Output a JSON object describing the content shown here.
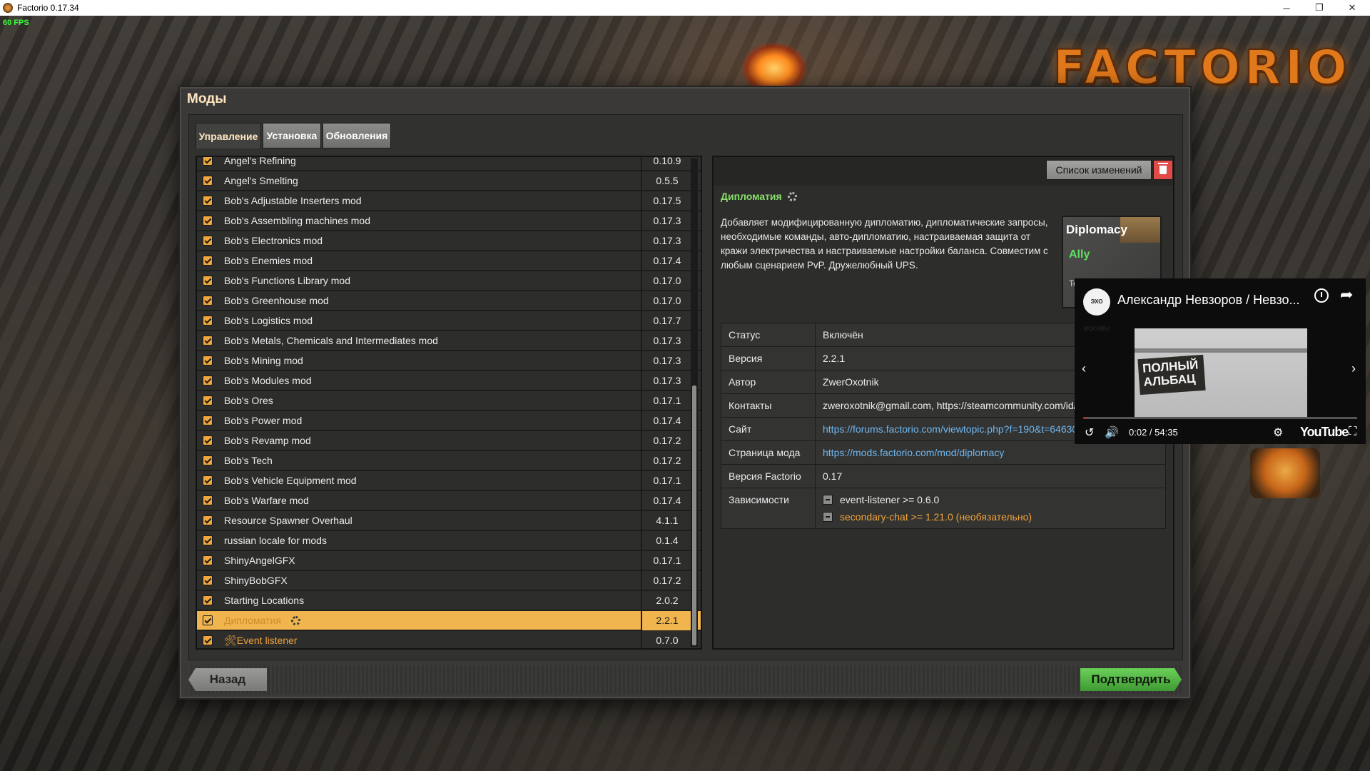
{
  "window": {
    "title": "Factorio 0.17.34",
    "minimize": "─",
    "maximize": "❐",
    "close": "✕"
  },
  "overlay": {
    "fps": "60 FPS",
    "logo": "FACTORIO"
  },
  "dialog": {
    "title": "Моды",
    "tabs": [
      {
        "label": "Управление",
        "active": true
      },
      {
        "label": "Установка",
        "active": false
      },
      {
        "label": "Обновления",
        "active": false
      }
    ]
  },
  "mods": [
    {
      "name": "Angel's Refining",
      "version": "0.10.9"
    },
    {
      "name": "Angel's Smelting",
      "version": "0.5.5"
    },
    {
      "name": "Bob's Adjustable Inserters mod",
      "version": "0.17.5"
    },
    {
      "name": "Bob's Assembling machines mod",
      "version": "0.17.3"
    },
    {
      "name": "Bob's Electronics mod",
      "version": "0.17.3"
    },
    {
      "name": "Bob's Enemies mod",
      "version": "0.17.4"
    },
    {
      "name": "Bob's Functions Library mod",
      "version": "0.17.0"
    },
    {
      "name": "Bob's Greenhouse mod",
      "version": "0.17.0"
    },
    {
      "name": "Bob's Logistics mod",
      "version": "0.17.7"
    },
    {
      "name": "Bob's Metals, Chemicals and Intermediates mod",
      "version": "0.17.3"
    },
    {
      "name": "Bob's Mining mod",
      "version": "0.17.3"
    },
    {
      "name": "Bob's Modules mod",
      "version": "0.17.3"
    },
    {
      "name": "Bob's Ores",
      "version": "0.17.1"
    },
    {
      "name": "Bob's Power mod",
      "version": "0.17.4"
    },
    {
      "name": "Bob's Revamp mod",
      "version": "0.17.2"
    },
    {
      "name": "Bob's Tech",
      "version": "0.17.2"
    },
    {
      "name": "Bob's Vehicle Equipment mod",
      "version": "0.17.1"
    },
    {
      "name": "Bob's Warfare mod",
      "version": "0.17.4"
    },
    {
      "name": "Resource Spawner Overhaul",
      "version": "4.1.1"
    },
    {
      "name": "russian locale for mods",
      "version": "0.1.4"
    },
    {
      "name": "ShinyAngelGFX",
      "version": "0.17.1"
    },
    {
      "name": "ShinyBobGFX",
      "version": "0.17.2"
    },
    {
      "name": "Starting Locations",
      "version": "2.0.2"
    },
    {
      "name": "Дипломатия",
      "version": "2.2.1",
      "selected": true
    },
    {
      "name": "🛠Event listener",
      "version": "0.7.0",
      "dependency": true
    }
  ],
  "details": {
    "changelog_label": "Список изменений",
    "mod_title": "Дипломатия",
    "description": "Добавляет модифицированную дипломатию, дипломатические запросы, необходимые команды, авто-дипломатию, настраиваемая защита от кражи электричества и настраиваемые настройки баланса. Совместим с любым сценарием PvP. Дружелюбный UPS.",
    "thumbnail": {
      "title": "Diplomacy",
      "ally": "Ally",
      "extra": "Te"
    },
    "info": [
      {
        "key": "Статус",
        "value": "Включён"
      },
      {
        "key": "Версия",
        "value": "2.2.1"
      },
      {
        "key": "Автор",
        "value": "ZwerOxotnik"
      },
      {
        "key": "Контакты",
        "value": "zweroxotnik@gmail.com, https://steamcommunity.com/id/zwer"
      },
      {
        "key": "Сайт",
        "value": "https://forums.factorio.com/viewtopic.php?f=190&t=64630",
        "link": true
      },
      {
        "key": "Страница мода",
        "value": "https://mods.factorio.com/mod/diplomacy",
        "link": true
      },
      {
        "key": "Версия Factorio",
        "value": "0.17"
      }
    ],
    "dependencies_label": "Зависимости",
    "dependencies": [
      {
        "text": "event-listener >= 0.6.0",
        "optional": false
      },
      {
        "text": "secondary-chat >= 1.21.0 (необязательно)",
        "optional": true
      }
    ]
  },
  "buttons": {
    "back": "Назад",
    "confirm": "Подтвердить"
  },
  "youtube": {
    "channel_avatar": "ЭХО МОСКВЫ",
    "title": "Александр Невзоров / Невзо...",
    "frame_text": "ПОЛНЫЙ АЛЬБАЦ",
    "time": "0:02 / 54:35",
    "progress": 0.0006,
    "logo": "YouTube",
    "prev": "‹",
    "next": "›",
    "replay": "↺",
    "volume": "🔊",
    "settings": "⚙",
    "fullscreen": "⛶",
    "share": "➦"
  }
}
